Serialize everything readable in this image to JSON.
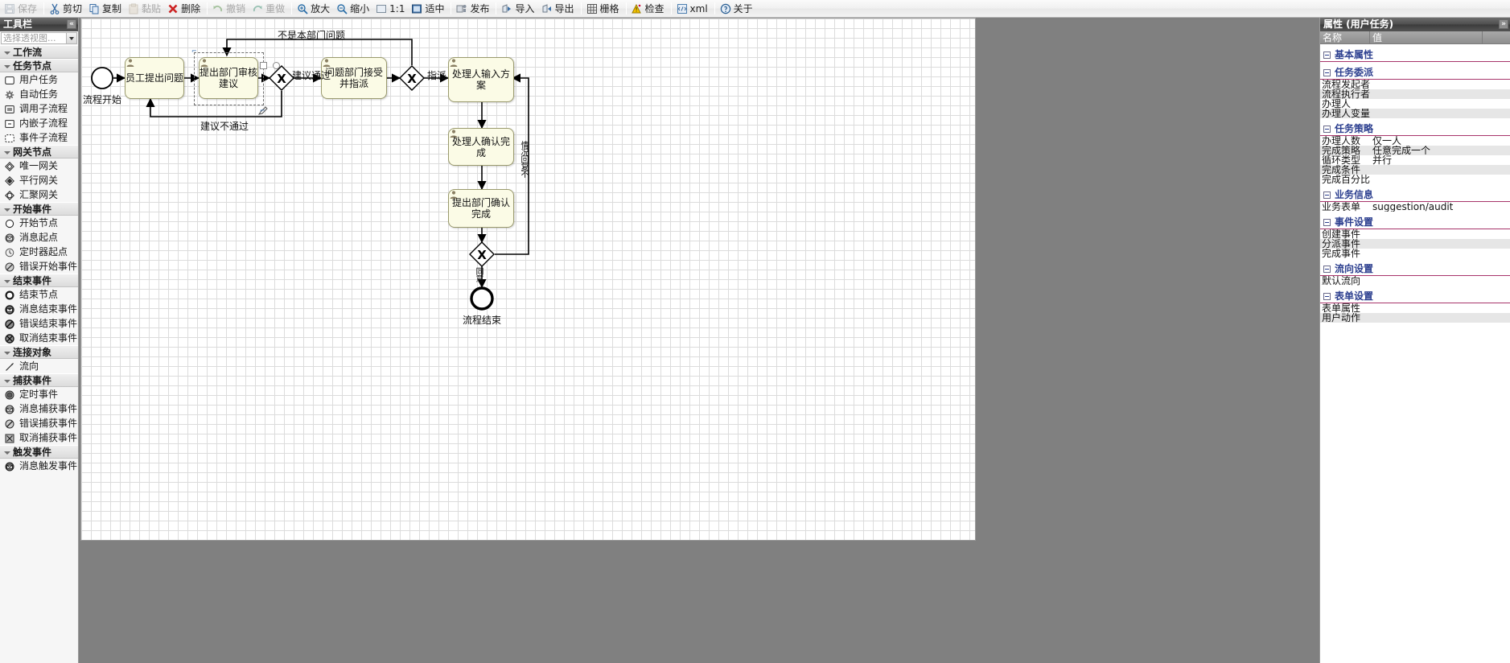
{
  "toolbar": {
    "items": [
      {
        "label": "保存",
        "icon": "save-icon",
        "disabled": true
      },
      {
        "sep": true
      },
      {
        "label": "剪切",
        "icon": "cut-icon",
        "disabled": false
      },
      {
        "label": "复制",
        "icon": "copy-icon",
        "disabled": false
      },
      {
        "label": "黏贴",
        "icon": "paste-icon",
        "disabled": true
      },
      {
        "label": "删除",
        "icon": "delete-icon",
        "disabled": false
      },
      {
        "sep": true
      },
      {
        "label": "撤销",
        "icon": "undo-icon",
        "disabled": true
      },
      {
        "label": "重做",
        "icon": "redo-icon",
        "disabled": true
      },
      {
        "sep": true
      },
      {
        "label": "放大",
        "icon": "zoom-in-icon",
        "disabled": false
      },
      {
        "label": "缩小",
        "icon": "zoom-out-icon",
        "disabled": false
      },
      {
        "label": "1:1",
        "icon": "zoom-actual-icon",
        "disabled": false
      },
      {
        "label": "适中",
        "icon": "zoom-fit-icon",
        "disabled": false
      },
      {
        "sep": true
      },
      {
        "label": "发布",
        "icon": "publish-icon",
        "disabled": false
      },
      {
        "sep": true
      },
      {
        "label": "导入",
        "icon": "import-icon",
        "disabled": false
      },
      {
        "label": "导出",
        "icon": "export-icon",
        "disabled": false
      },
      {
        "sep": true
      },
      {
        "label": "栅格",
        "icon": "grid-icon",
        "disabled": false
      },
      {
        "sep": true
      },
      {
        "label": "检查",
        "icon": "check-icon",
        "disabled": false
      },
      {
        "sep": true
      },
      {
        "label": "xml",
        "icon": "xml-icon",
        "disabled": false
      },
      {
        "sep": true
      },
      {
        "label": "关于",
        "icon": "about-icon",
        "disabled": false
      }
    ]
  },
  "palette": {
    "title": "工具栏",
    "collapse_glyph": "«",
    "perspective_placeholder": "选择透视图...",
    "groups": [
      {
        "label": "工作流",
        "items": []
      },
      {
        "label": "任务节点",
        "items": [
          {
            "label": "用户任务",
            "icon": "user-task-icon"
          },
          {
            "label": "自动任务",
            "icon": "service-task-icon"
          },
          {
            "label": "调用子流程",
            "icon": "call-subprocess-icon"
          },
          {
            "label": "内嵌子流程",
            "icon": "embedded-subprocess-icon"
          },
          {
            "label": "事件子流程",
            "icon": "event-subprocess-icon"
          }
        ]
      },
      {
        "label": "网关节点",
        "items": [
          {
            "label": "唯一网关",
            "icon": "exclusive-gateway-icon"
          },
          {
            "label": "平行网关",
            "icon": "parallel-gateway-icon"
          },
          {
            "label": "汇聚网关",
            "icon": "inclusive-gateway-icon"
          }
        ]
      },
      {
        "label": "开始事件",
        "items": [
          {
            "label": "开始节点",
            "icon": "start-node-icon"
          },
          {
            "label": "消息起点",
            "icon": "message-start-icon"
          },
          {
            "label": "定时器起点",
            "icon": "timer-start-icon"
          },
          {
            "label": "错误开始事件",
            "icon": "error-start-icon"
          }
        ]
      },
      {
        "label": "结束事件",
        "items": [
          {
            "label": "结束节点",
            "icon": "end-node-icon"
          },
          {
            "label": "消息结束事件",
            "icon": "message-end-icon"
          },
          {
            "label": "错误结束事件",
            "icon": "error-end-icon"
          },
          {
            "label": "取消结束事件",
            "icon": "cancel-end-icon"
          }
        ]
      },
      {
        "label": "连接对象",
        "items": [
          {
            "label": "流向",
            "icon": "sequence-flow-icon"
          }
        ]
      },
      {
        "label": "捕获事件",
        "items": [
          {
            "label": "定时事件",
            "icon": "timer-catch-icon"
          },
          {
            "label": "消息捕获事件",
            "icon": "message-catch-icon"
          },
          {
            "label": "错误捕获事件",
            "icon": "error-catch-icon"
          },
          {
            "label": "取消捕获事件",
            "icon": "cancel-catch-icon"
          }
        ]
      },
      {
        "label": "触发事件",
        "items": [
          {
            "label": "消息触发事件",
            "icon": "message-throw-icon"
          }
        ]
      }
    ]
  },
  "diagram": {
    "start_label": "流程开始",
    "end_label": "流程结束",
    "tasks": [
      {
        "id": "t1",
        "label": "员工提出问题"
      },
      {
        "id": "t2",
        "label": "提出部门审核建议"
      },
      {
        "id": "t3",
        "label": "问题部门接受并指派"
      },
      {
        "id": "t4",
        "label": "处理人输入方案"
      },
      {
        "id": "t5",
        "label": "处理人确认完成"
      },
      {
        "id": "t6",
        "label": "提出部门确认完成"
      }
    ],
    "gateways": [
      {
        "id": "g1",
        "glyph": "X"
      },
      {
        "id": "g2",
        "glyph": "X"
      },
      {
        "id": "g3",
        "glyph": "X"
      }
    ],
    "edge_labels": [
      {
        "id": "e1",
        "text": "不是本部门问题"
      },
      {
        "id": "e2",
        "text": "建议通过"
      },
      {
        "id": "e3",
        "text": "建议不通过"
      },
      {
        "id": "e4",
        "text": "指派"
      },
      {
        "id": "e5",
        "text": "情况回复不"
      },
      {
        "id": "e6",
        "text": "同意"
      }
    ]
  },
  "properties": {
    "title": "属性 (用户任务)",
    "collapse_glyph": "»",
    "header": {
      "name": "名称",
      "value": "值",
      "extra": ""
    },
    "sections": [
      {
        "label": "基本属性",
        "rows": []
      },
      {
        "label": "任务委派",
        "rows": [
          {
            "key": "流程发起者",
            "value": ""
          },
          {
            "key": "流程执行者",
            "value": ""
          },
          {
            "key": "办理人",
            "value": ""
          },
          {
            "key": "办理人变量",
            "value": ""
          }
        ]
      },
      {
        "label": "任务策略",
        "rows": [
          {
            "key": "办理人数",
            "value": "仅一人"
          },
          {
            "key": "完成策略",
            "value": "任意完成一个"
          },
          {
            "key": "循环类型",
            "value": "并行"
          },
          {
            "key": "完成条件",
            "value": ""
          },
          {
            "key": "完成百分比",
            "value": ""
          }
        ]
      },
      {
        "label": "业务信息",
        "rows": [
          {
            "key": "业务表单",
            "value": "suggestion/audit"
          }
        ]
      },
      {
        "label": "事件设置",
        "rows": [
          {
            "key": "创建事件",
            "value": ""
          },
          {
            "key": "分派事件",
            "value": ""
          },
          {
            "key": "完成事件",
            "value": ""
          }
        ]
      },
      {
        "label": "流向设置",
        "rows": [
          {
            "key": "默认流向",
            "value": ""
          }
        ]
      },
      {
        "label": "表单设置",
        "rows": [
          {
            "key": "表单属性",
            "value": ""
          },
          {
            "key": "用户动作",
            "value": ""
          }
        ]
      }
    ]
  },
  "colors": {
    "task_fill": "#fbfbe6",
    "task_stroke": "#9a9a6e",
    "section_rule": "#a8356b",
    "section_text": "#2c3f8f",
    "canvas_bg": "#808080"
  }
}
